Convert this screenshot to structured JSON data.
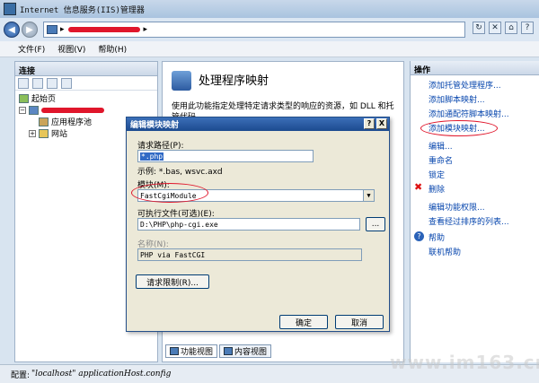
{
  "window": {
    "title": "Internet 信息服务(IIS)管理器"
  },
  "address": {
    "separator": "▸"
  },
  "menu": {
    "file": "文件(F)",
    "view": "视图(V)",
    "help": "帮助(H)"
  },
  "connections": {
    "header": "连接",
    "tree": [
      {
        "label": "起始页"
      },
      {
        "label": "应用程序池"
      },
      {
        "label": "网站"
      }
    ]
  },
  "content": {
    "title": "处理程序映射",
    "description": "使用此功能指定处理特定请求类型的响应的资源，如 DLL 和托管代码。",
    "tabs": {
      "feature_view": "功能视图",
      "content_view": "内容视图"
    }
  },
  "actions": {
    "header": "操作",
    "items": [
      "添加托管处理程序...",
      "添加脚本映射...",
      "添加通配符脚本映射...",
      "添加模块映射...",
      "编辑...",
      "重命名",
      "锁定",
      "删除",
      "编辑功能权限...",
      "查看经过排序的列表...",
      "帮助",
      "联机帮助"
    ]
  },
  "dialog": {
    "title": "编辑模块映射",
    "request_path_label": "请求路径(P):",
    "request_path_value": "*.php",
    "example": "示例: *.bas, wsvc.axd",
    "module_label": "模块(M):",
    "module_value": "FastCgiModule",
    "executable_label": "可执行文件(可选)(E):",
    "executable_value": "D:\\PHP\\php-cgi.exe",
    "browse_label": "...",
    "name_label": "名称(N):",
    "name_value": "PHP via FastCGI",
    "restrictions_button": "请求限制(R)...",
    "ok_button": "确定",
    "cancel_button": "取消",
    "help_btn": "?",
    "close_btn": "X"
  },
  "status": {
    "prefix": "配置:",
    "path": "\"localhost\" applicationHost.config"
  },
  "watermark": "www.im163.cn",
  "colors": {
    "link": "#0645ad",
    "annotation": "#e0162b",
    "dialog_title": "#1c4a8f"
  }
}
